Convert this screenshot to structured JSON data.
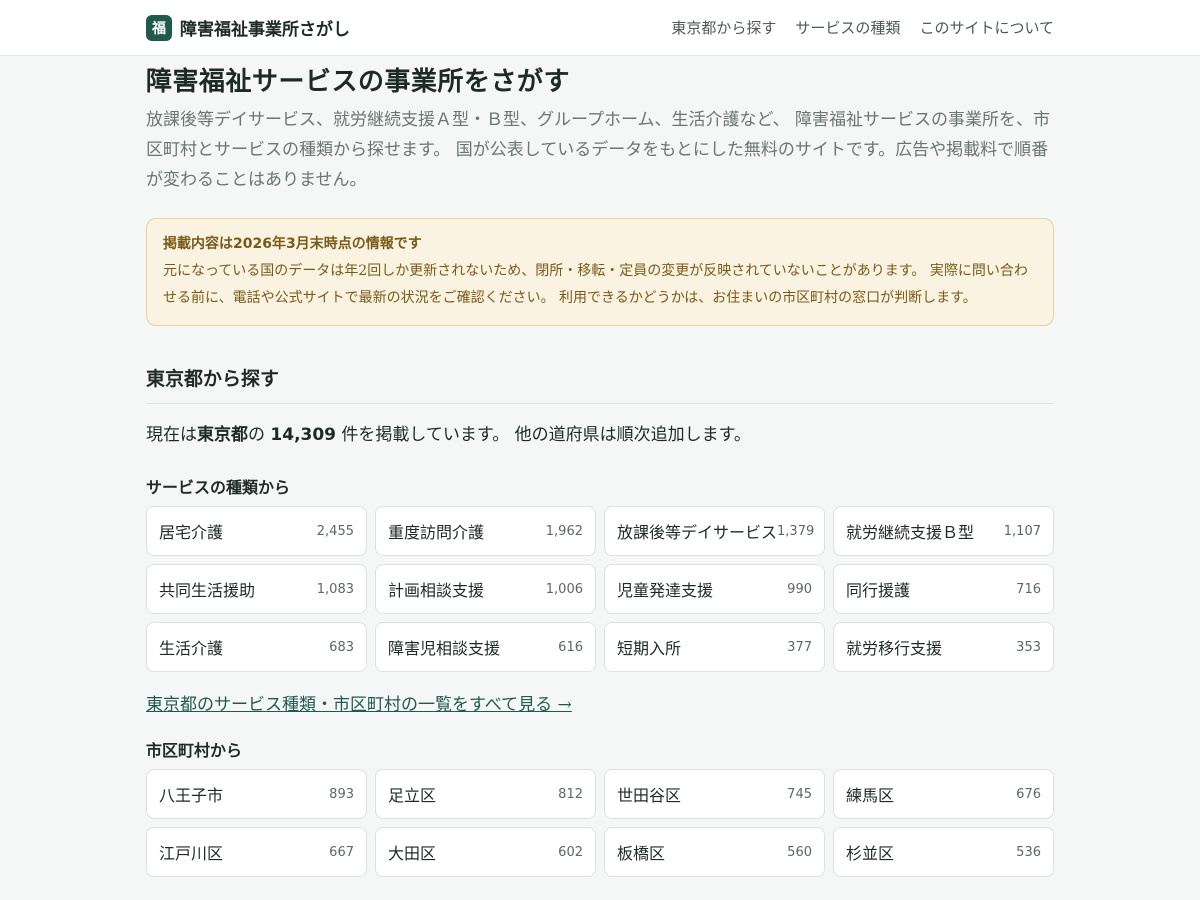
{
  "header": {
    "logo_char": "福",
    "site_name": "障害福祉事業所さがし",
    "nav": [
      "東京都から探す",
      "サービスの種類",
      "このサイトについて"
    ]
  },
  "main": {
    "title": "障害福祉サービスの事業所をさがす",
    "intro": "放課後等デイサービス、就労継続支援Ａ型・Ｂ型、グループホーム、生活介護など、 障害福祉サービスの事業所を、市区町村とサービスの種類から探せます。 国が公表しているデータをもとにした無料のサイトです。広告や掲載料で順番が変わることはありません。",
    "notice": {
      "title": "掲載内容は2026年3月末時点の情報です",
      "body": "元になっている国のデータは年2回しか更新されないため、閉所・移転・定員の変更が反映されていないことがあります。 実際に問い合わせる前に、電話や公式サイトで最新の状況をご確認ください。 利用できるかどうかは、お住まいの市区町村の窓口が判断します。"
    },
    "section_heading": "東京都から探す",
    "summary": {
      "prefix": "現在は",
      "prefecture": "東京都",
      "middle": "の ",
      "count": "14,309",
      "suffix": " 件を掲載しています。 他の道府県は順次追加します。"
    },
    "services_heading": "サービスの種類から",
    "services": [
      {
        "label": "居宅介護",
        "count": "2,455"
      },
      {
        "label": "重度訪問介護",
        "count": "1,962"
      },
      {
        "label": "放課後等デイサービス",
        "count": "1,379"
      },
      {
        "label": "就労継続支援Ｂ型",
        "count": "1,107"
      },
      {
        "label": "共同生活援助",
        "count": "1,083"
      },
      {
        "label": "計画相談支援",
        "count": "1,006"
      },
      {
        "label": "児童発達支援",
        "count": "990"
      },
      {
        "label": "同行援護",
        "count": "716"
      },
      {
        "label": "生活介護",
        "count": "683"
      },
      {
        "label": "障害児相談支援",
        "count": "616"
      },
      {
        "label": "短期入所",
        "count": "377"
      },
      {
        "label": "就労移行支援",
        "count": "353"
      }
    ],
    "see_all_link": "東京都のサービス種類・市区町村の一覧をすべて見る →",
    "cities_heading": "市区町村から",
    "cities": [
      {
        "label": "八王子市",
        "count": "893"
      },
      {
        "label": "足立区",
        "count": "812"
      },
      {
        "label": "世田谷区",
        "count": "745"
      },
      {
        "label": "練馬区",
        "count": "676"
      },
      {
        "label": "江戸川区",
        "count": "667"
      },
      {
        "label": "大田区",
        "count": "602"
      },
      {
        "label": "板橋区",
        "count": "560"
      },
      {
        "label": "杉並区",
        "count": "536"
      }
    ]
  }
}
